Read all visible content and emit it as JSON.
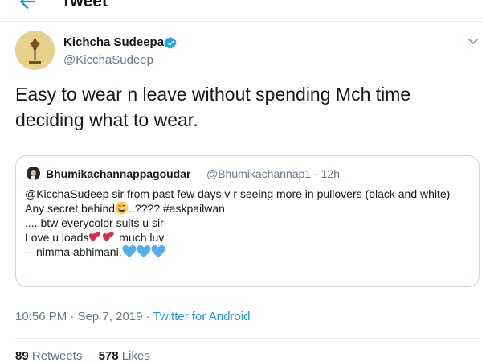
{
  "header": {
    "title": "Tweet",
    "back_icon": "arrow-left-icon"
  },
  "colors": {
    "accent": "#1b95e0",
    "text": "#14171a",
    "secondary_text": "#657786",
    "border": "#ccd6dd"
  },
  "tweet": {
    "author_name": "Kichcha Sudeepa",
    "author_handle": "@KicchaSudeep",
    "verified": true,
    "text": "Easy to wear n leave without spending Mch time deciding what to wear.",
    "time": "10:56 PM",
    "separator": "·",
    "date": "Sep 7, 2019",
    "source": "Twitter for Android",
    "retweets_count": "89",
    "retweets_label": "Retweets",
    "likes_count": "578",
    "likes_label": "Likes"
  },
  "quoted_tweet": {
    "author_name": "Bhumikachannappagoudar",
    "author_handle": "@Bhumikachannap1",
    "time": "12h",
    "line1": "@KicchaSudeep  sir from past few days v r seeing more in pullovers (black and white)",
    "line2_before": "Any secret behind",
    "line2_after": "..???? #askpailwan",
    "line3": ".....btw everycolor suits u sir",
    "line4_before": "Love u loads",
    "line4_after": "  much luv",
    "line5": "---nimma abhimani.",
    "emojis": [
      "grinning-face-icon",
      "two-hearts-icon",
      "blue-heart-icon"
    ]
  }
}
